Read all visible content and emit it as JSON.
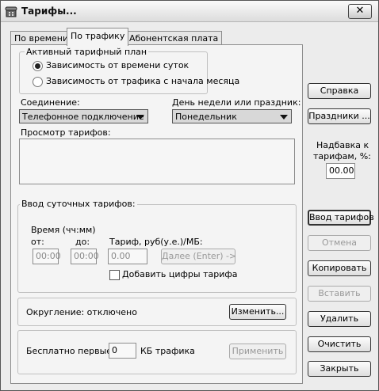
{
  "window": {
    "title": "Тарифы..."
  },
  "tabs": [
    {
      "label": "По времени"
    },
    {
      "label": "По трафику"
    },
    {
      "label": "Абонентская плата"
    }
  ],
  "active_plan": {
    "legend": "Активный тарифный план",
    "option_time": "Зависимость от времени суток",
    "option_traffic": "Зависимость от трафика с начала месяца",
    "selected": "option_time"
  },
  "connection": {
    "label": "Соединение:",
    "value": "Телефонное подключение"
  },
  "weekday": {
    "label": "День недели или праздник:",
    "value": "Понедельник"
  },
  "preview": {
    "label": "Просмотр тарифов:"
  },
  "daily": {
    "legend": "Ввод суточных тарифов:",
    "time_label": "Время (чч:мм)",
    "from_label": "от:",
    "to_label": "до:",
    "tariff_label": "Тариф, руб(у.е.)/МБ:",
    "from_value": "00:00",
    "to_value": "00:00",
    "tariff_value": "0.00",
    "next_button": "Далее (Enter) ->",
    "add_digits_label": "Добавить цифры тарифа"
  },
  "rounding": {
    "text": "Округление: отключено",
    "change_button": "Изменить..."
  },
  "free": {
    "prefix": "Бесплатно первые",
    "value": "0",
    "suffix": "КБ трафика",
    "apply_button": "Применить"
  },
  "right": {
    "help_button": "Справка",
    "holidays_button": "Праздники ...",
    "markup_label_1": "Надбавка к",
    "markup_label_2": "тарифам, %:",
    "markup_value": "00.00",
    "enter_tariffs_button": "Ввод тарифов",
    "cancel_button": "Отмена",
    "copy_button": "Копировать",
    "paste_button": "Вставить",
    "delete_button": "Удалить",
    "clear_button": "Очистить",
    "close_button": "Закрыть"
  },
  "icons": {
    "app": "phone-icon",
    "close": "close-icon"
  }
}
